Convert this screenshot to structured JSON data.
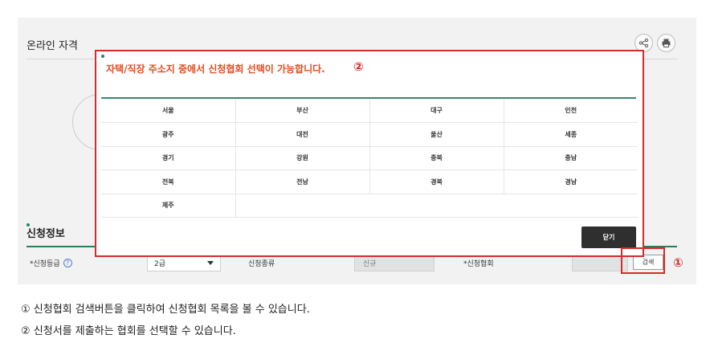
{
  "page": {
    "title": "온라인 자격",
    "share_icon": "share-icon",
    "print_icon": "print-icon"
  },
  "section": {
    "title": "신청정보"
  },
  "form": {
    "grade_label": "*신청등급",
    "grade_value": "2급",
    "type_label": "신청종류",
    "type_value": "신규",
    "assoc_label": "*신청협회",
    "assoc_value": "",
    "search_label": "검색"
  },
  "markers": {
    "one": "①",
    "two": "②"
  },
  "modal": {
    "title": "자택/직장 주소지 중에서 신청협회 선택이 가능합니다.",
    "regions": [
      [
        "서울",
        "부산",
        "대구",
        "인천"
      ],
      [
        "광주",
        "대전",
        "울산",
        "세종"
      ],
      [
        "경기",
        "강원",
        "충북",
        "충남"
      ],
      [
        "전북",
        "전남",
        "경북",
        "경남"
      ],
      [
        "제주"
      ]
    ],
    "close_label": "닫기"
  },
  "notes": [
    "① 신청협회 검색버튼을 클릭하여 신청협회 목록을 볼 수 있습니다.",
    "② 신청서를 제출하는 협회를 선택할 수 있습니다."
  ]
}
